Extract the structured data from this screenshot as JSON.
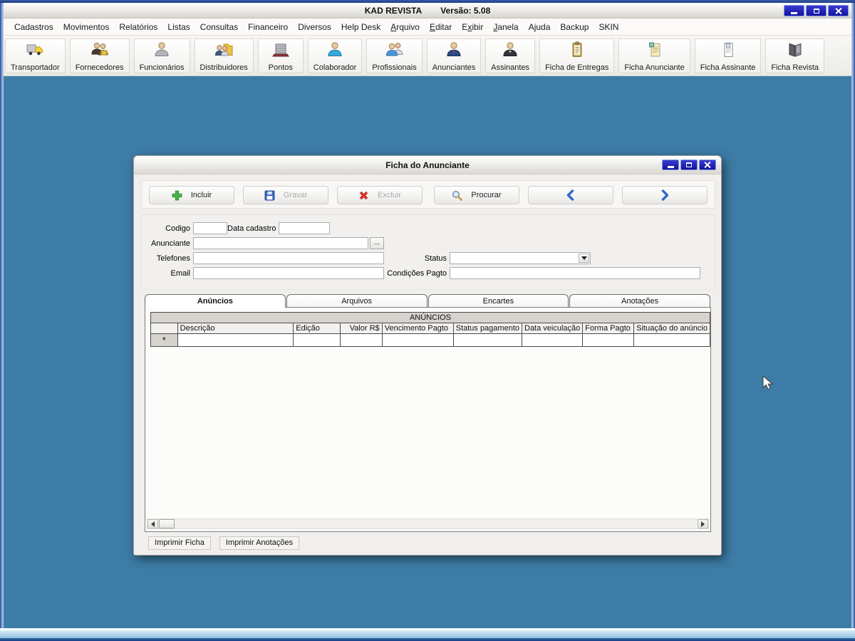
{
  "window": {
    "title": "KAD REVISTA",
    "version": "Versão: 5.08"
  },
  "menubar": {
    "items": [
      {
        "label": "Cadastros"
      },
      {
        "label": "Movimentos"
      },
      {
        "label": "Relatórios"
      },
      {
        "label": "Listas"
      },
      {
        "label": "Consultas"
      },
      {
        "label": "Financeiro"
      },
      {
        "label": "Diversos"
      },
      {
        "label": "Help Desk"
      },
      {
        "label": "Arquivo",
        "accel": "A"
      },
      {
        "label": "Editar",
        "accel": "E"
      },
      {
        "label": "Exibir",
        "accel": "x"
      },
      {
        "label": "Janela",
        "accel": "J"
      },
      {
        "label": "Ajuda"
      },
      {
        "label": "Backup"
      },
      {
        "label": "SKIN"
      }
    ]
  },
  "toolbar": {
    "buttons": [
      {
        "label": "Transportador",
        "icon": "truck-icon"
      },
      {
        "label": "Fornecedores",
        "icon": "suppliers-icon"
      },
      {
        "label": "Funcionários",
        "icon": "employee-icon"
      },
      {
        "label": "Distribuidores",
        "icon": "distributors-icon"
      },
      {
        "label": "Pontos",
        "icon": "building-icon"
      },
      {
        "label": "Colaborador",
        "icon": "collaborator-icon"
      },
      {
        "label": "Profissionais",
        "icon": "professionals-icon"
      },
      {
        "label": "Anunciantes",
        "icon": "advertisers-icon"
      },
      {
        "label": "Assinantes",
        "icon": "subscribers-icon"
      },
      {
        "label": "Ficha de Entregas",
        "icon": "clipboard-icon"
      },
      {
        "label": "Ficha Anunciante",
        "icon": "document-note-icon"
      },
      {
        "label": "Ficha Assinante",
        "icon": "document-icon"
      },
      {
        "label": "Ficha Revista",
        "icon": "book-icon"
      }
    ]
  },
  "dialog": {
    "title": "Ficha do Anunciante",
    "toolbar": {
      "buttons": [
        {
          "label": "Incluir",
          "icon": "plus-icon",
          "enabled": true
        },
        {
          "label": "Gravar",
          "icon": "save-icon",
          "enabled": false
        },
        {
          "label": "Excluir",
          "icon": "delete-icon",
          "enabled": false
        },
        {
          "label": "Procurar",
          "icon": "search-icon",
          "enabled": true
        },
        {
          "label": "",
          "icon": "prev-icon",
          "enabled": true
        },
        {
          "label": "",
          "icon": "next-icon",
          "enabled": true
        }
      ]
    },
    "form": {
      "codigo_label": "Codigo",
      "codigo_value": "",
      "data_cadastro_label": "Data cadastro",
      "data_cadastro_value": "",
      "anunciante_label": "Anunciante",
      "anunciante_value": "",
      "browse_label": "...",
      "telefones_label": "Telefones",
      "telefones_value": "",
      "status_label": "Status",
      "status_value": "",
      "email_label": "Email",
      "email_value": "",
      "condicoes_label": "Condições Pagto",
      "condicoes_value": ""
    },
    "tabs": [
      {
        "label": "Anúncios",
        "active": true
      },
      {
        "label": "Arquivos",
        "active": false
      },
      {
        "label": "Encartes",
        "active": false
      },
      {
        "label": "Anotações",
        "active": false
      }
    ],
    "grid": {
      "group_header": "ANÚNCIOS",
      "columns": [
        "",
        "Descrição",
        "Edição",
        "Valor R$",
        "Vencimento Pagto",
        "Status pagamento",
        "Data veiculação",
        "Forma Pagto",
        "Situação do anúncio"
      ],
      "new_row_marker": "*"
    },
    "footer": {
      "print_ficha_label": "Imprimir Ficha",
      "print_anotacoes_label": "Imprimir Anotações"
    }
  },
  "icons": {
    "minimize-icon": "white horizontal bar",
    "maximize-icon": "white square outline",
    "close-icon": "white X cross",
    "plus-icon": "green plus",
    "save-icon": "blue floppy disk",
    "delete-icon": "red X",
    "search-icon": "magnifying glass",
    "prev-icon": "blue chevron left",
    "next-icon": "blue chevron right",
    "chevron-down-icon": "black down triangle"
  },
  "colors": {
    "desktop": "#3D7CA6",
    "titlebar_button": "#1212A0",
    "accent_blue": "#2E6BD0",
    "grid_header": "#D6D3CE"
  }
}
